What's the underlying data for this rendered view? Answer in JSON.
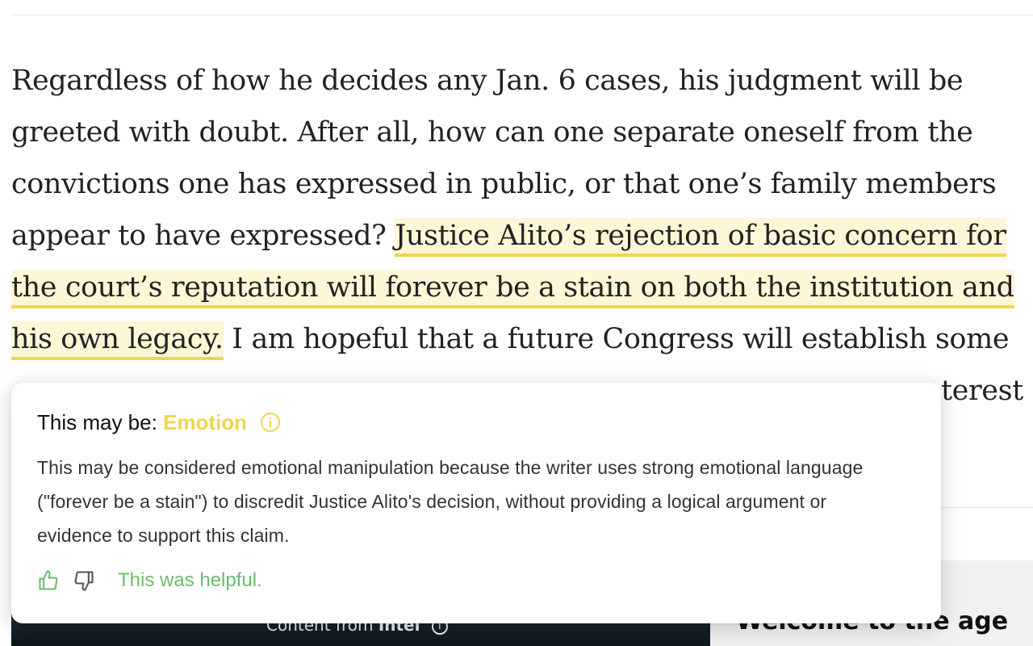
{
  "article": {
    "lines": [
      {
        "before": "Regardless of how he decides any Jan. 6 cases, his judgment will be",
        "highlight": "",
        "after": ""
      },
      {
        "before": "greeted with doubt. After all, how can one separate oneself from the",
        "highlight": "",
        "after": ""
      },
      {
        "before": "convictions one has expressed in public, or that one’s family members",
        "highlight": "",
        "after": ""
      },
      {
        "before": "appear to have expressed? ",
        "highlight": "Justice Alito’s rejection of basic concern for",
        "after": ""
      },
      {
        "before": "",
        "highlight": "the court’s reputation will forever be a stain on both the institution and",
        "after": ""
      },
      {
        "before": "",
        "highlight": "his own legacy.",
        "after": " I am hopeful that a future Congress will establish some"
      },
      {
        "before": "",
        "highlight": "",
        "after": "terest"
      }
    ]
  },
  "popup": {
    "title_prefix": "This may be:",
    "category": "Emotion",
    "body": "This may be considered emotional manipulation because the writer uses strong emotional language (\"forever be a stain\") to discredit Justice Alito's decision, without providing a logical argument or evidence to support this claim.",
    "helpful_text": "This was helpful.",
    "icons": [
      "info-icon",
      "thumbs-up-icon",
      "thumbs-down-icon"
    ]
  },
  "video": {
    "caption_prefix": "Content from",
    "caption_brand": "Intel"
  },
  "sidebar": {
    "heading": "Welcome to the age"
  },
  "colors": {
    "highlight_bg": "#fdf6d7",
    "highlight_underline": "#f2d54f",
    "category": "#f2d54f",
    "helpful": "#6dbb6d"
  }
}
